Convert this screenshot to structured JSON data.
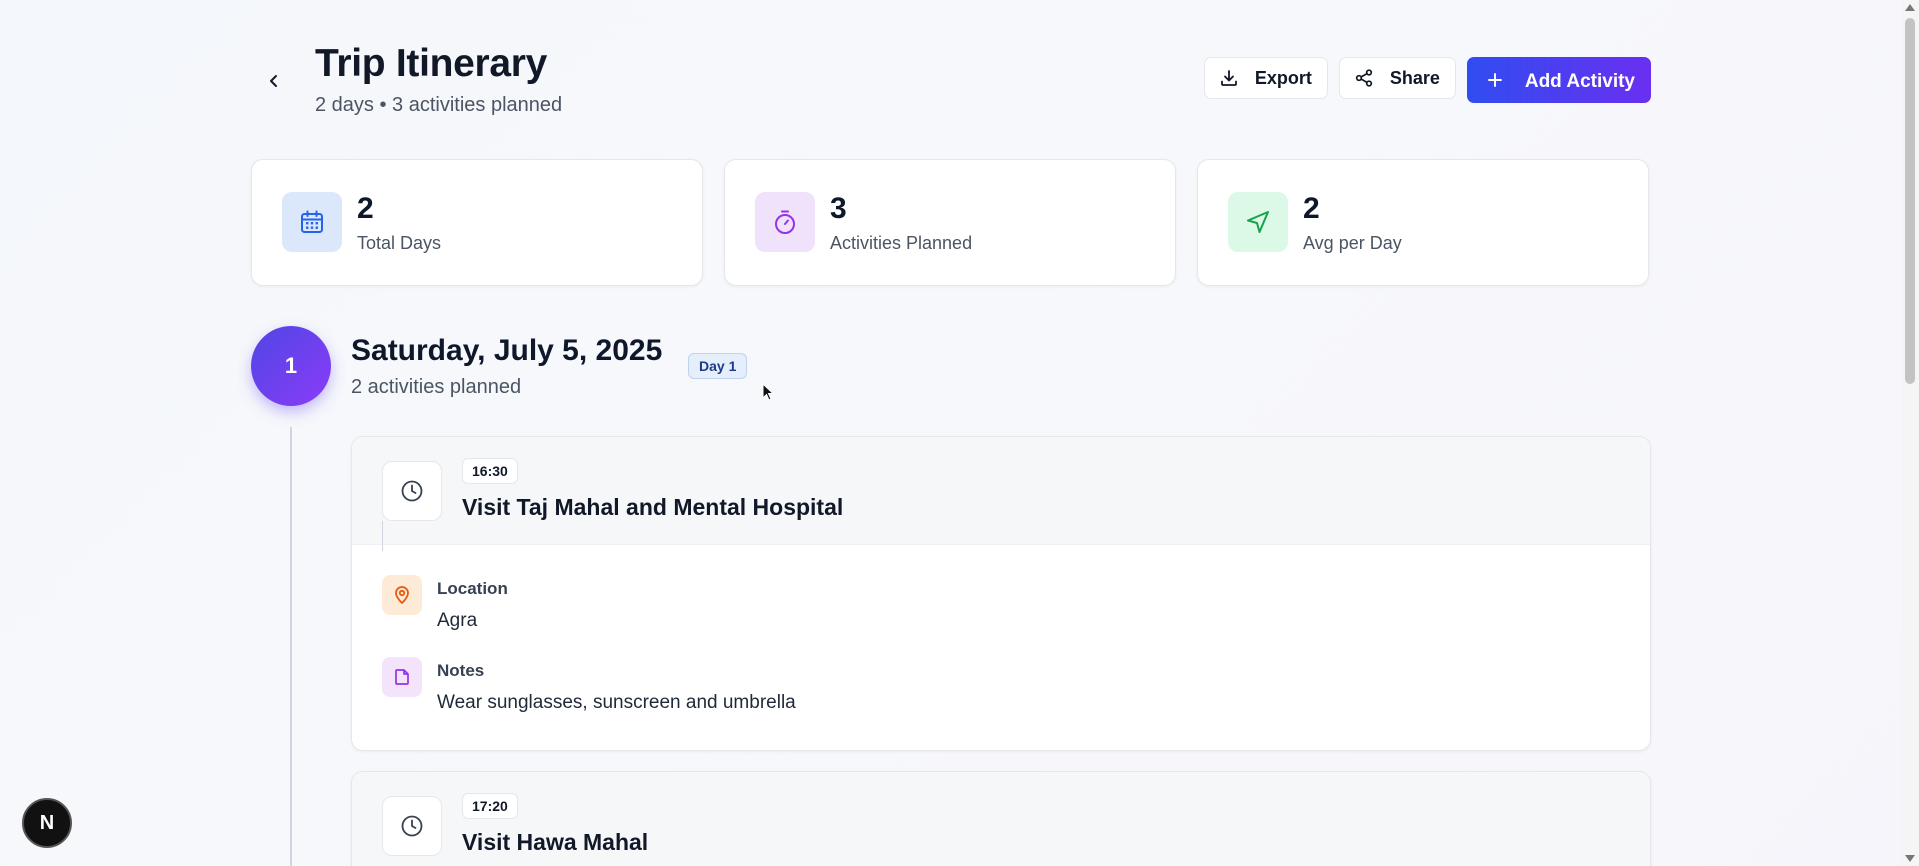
{
  "header": {
    "title": "Trip Itinerary",
    "subtitle": "2 days • 3 activities planned",
    "export_label": "Export",
    "share_label": "Share",
    "add_activity_label": "Add Activity"
  },
  "stats": [
    {
      "value": "2",
      "label": "Total Days",
      "icon": "calendar-icon",
      "icon_bg": "#dbe7fb",
      "icon_color": "#2563eb"
    },
    {
      "value": "3",
      "label": "Activities Planned",
      "icon": "stopwatch-icon",
      "icon_bg": "#f1e2fb",
      "icon_color": "#9333ea"
    },
    {
      "value": "2",
      "label": "Avg per Day",
      "icon": "navigation-icon",
      "icon_bg": "#dcf8e6",
      "icon_color": "#16a34a"
    }
  ],
  "day": {
    "number": "1",
    "title": "Saturday, July 5, 2025",
    "subtitle": "2 activities planned",
    "badge": "Day 1"
  },
  "activities": [
    {
      "time": "16:30",
      "title": "Visit Taj Mahal and Mental Hospital",
      "location_label": "Location",
      "location": "Agra",
      "notes_label": "Notes",
      "notes": "Wear sunglasses, sunscreen and umbrella"
    },
    {
      "time": "17:20",
      "title": "Visit Hawa Mahal"
    }
  ],
  "colors": {
    "primary_start": "#2f4df0",
    "primary_end": "#6a2ff0",
    "location_icon": "#ea580c",
    "notes_icon": "#9333ea"
  },
  "logo_letter": "N"
}
